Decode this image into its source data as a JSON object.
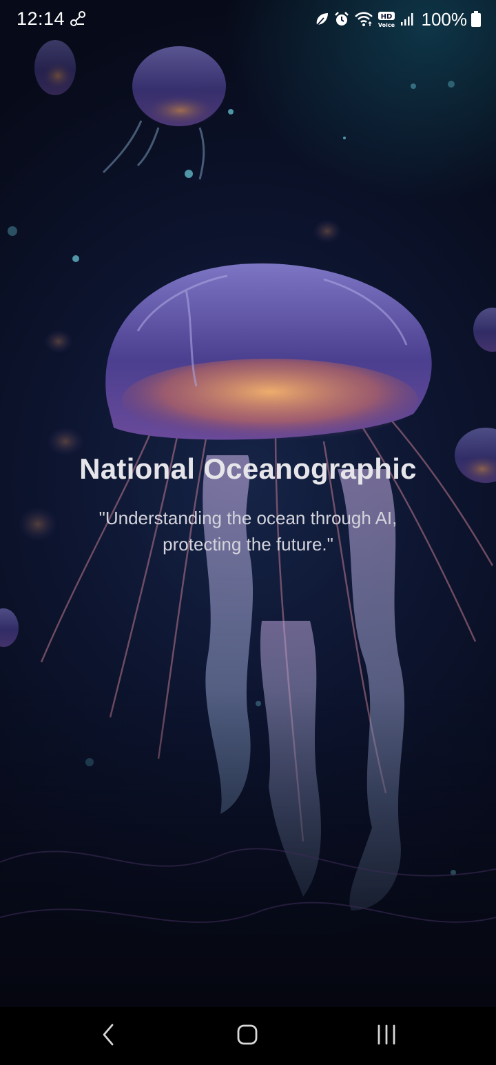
{
  "status_bar": {
    "time": "12:14",
    "battery_text": "100%",
    "left_icon": "link-icon",
    "right_icons": [
      "leaf-icon",
      "alarm-icon",
      "wifi-icon",
      "hd-voice-icon",
      "signal-icon",
      "battery-icon"
    ],
    "hd_label": "HD",
    "voice_label": "Voice"
  },
  "splash": {
    "title": "National Oceanographic",
    "tagline": "\"Understanding the ocean through AI, protecting the future.\""
  },
  "nav_bar": {
    "buttons": [
      "back-icon",
      "home-icon",
      "recents-icon"
    ]
  },
  "colors": {
    "title": "#e6e6ea",
    "tagline": "#d4d4dc",
    "background_deep": "#070a18",
    "jelly_bell": "#5a4fa3",
    "jelly_glow": "#f0a060"
  }
}
